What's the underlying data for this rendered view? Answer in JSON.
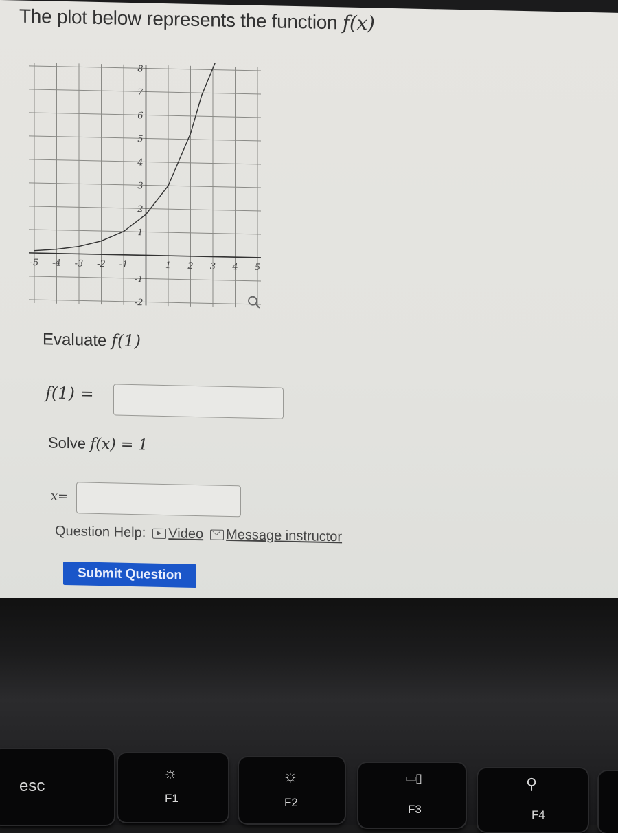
{
  "page": {
    "title_prefix": "The plot below represents the function ",
    "title_func": "f(x)"
  },
  "chart_data": {
    "type": "line",
    "title": "",
    "xlabel": "",
    "ylabel": "",
    "xlim": [
      -5,
      5
    ],
    "ylim": [
      -2,
      8
    ],
    "x_ticks": [
      "-5",
      "-4",
      "-3",
      "-2",
      "-1",
      "1",
      "2",
      "3",
      "4",
      "5"
    ],
    "y_ticks": [
      "-2",
      "-1",
      "1",
      "2",
      "3",
      "4",
      "5",
      "6",
      "7",
      "8"
    ],
    "grid": true,
    "series": [
      {
        "name": "f(x)",
        "x": [
          -5,
          -4,
          -3,
          -2,
          -1,
          0,
          1,
          2,
          2.5,
          3.1
        ],
        "y": [
          0.1,
          0.18,
          0.32,
          0.57,
          1,
          1.75,
          3,
          5.25,
          6.9,
          8.5
        ]
      }
    ],
    "annotations": [
      "magnifier-icon at bottom-right"
    ]
  },
  "question1": {
    "prompt_prefix": "Evaluate ",
    "prompt_math": "f(1)",
    "label": "f(1) =",
    "input_value": ""
  },
  "question2": {
    "prompt_prefix": "Solve ",
    "prompt_math": "f(x) = 1",
    "label": "x=",
    "input_value": ""
  },
  "help": {
    "label": "Question Help:",
    "video": "Video",
    "message": "Message instructor"
  },
  "submit_label": "Submit Question",
  "keyboard": {
    "esc": "esc",
    "f1": "F1",
    "f2": "F2",
    "f3": "F3",
    "f4": "F4"
  }
}
